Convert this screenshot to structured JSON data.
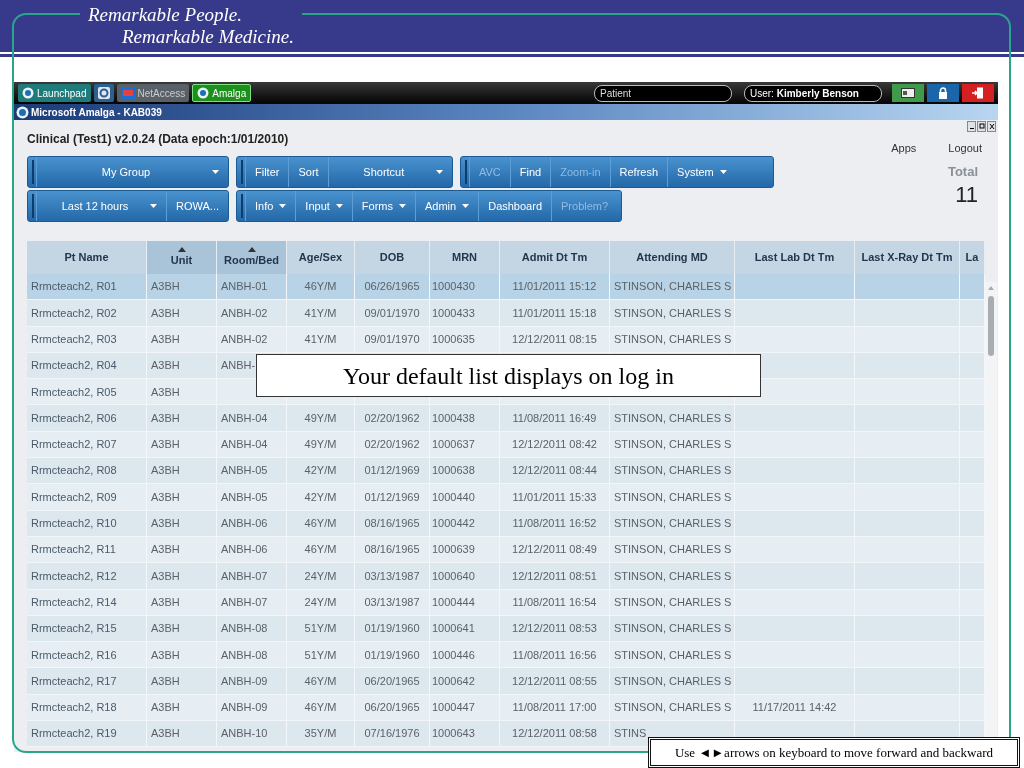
{
  "slide": {
    "tagline": [
      "Remarkable People.",
      "Remarkable Medicine."
    ]
  },
  "taskbar": {
    "tabs": [
      {
        "kind": "launchpad",
        "label": "Launchpad",
        "selected": false
      },
      {
        "kind": "icon",
        "selected": false
      },
      {
        "kind": "netaccess",
        "label": "NetAccess",
        "selected": false
      },
      {
        "kind": "amalga",
        "label": "Amalga",
        "selected": true
      }
    ],
    "patient_field": {
      "placeholder": "Patient"
    },
    "user_field": {
      "value": "User: **Kimberly Benson**"
    }
  },
  "window": {
    "title": "Microsoft Amalga - KAB039"
  },
  "app": {
    "title": "Clinical (Test1) v2.0.24 (Data epoch:1/01/2010)",
    "links": [
      "Apps",
      "Logout"
    ],
    "total": {
      "label": "Total",
      "value": "11"
    },
    "toolbars": [
      [
        {
          "label": "My Group",
          "dropdown": true,
          "disabled": false,
          "grow": true
        }
      ],
      [
        {
          "label": "Filter",
          "dropdown": false,
          "disabled": false
        },
        {
          "label": "Sort",
          "dropdown": false,
          "disabled": false
        },
        {
          "label": "Shortcut",
          "dropdown": true,
          "disabled": false,
          "grow": true
        }
      ],
      [
        {
          "label": "AVC",
          "dropdown": false,
          "disabled": true
        },
        {
          "label": "Find",
          "dropdown": false,
          "disabled": false
        },
        {
          "label": "Zoom-in",
          "dropdown": false,
          "disabled": true
        },
        {
          "label": "Refresh",
          "dropdown": false,
          "disabled": false
        },
        {
          "label": "System",
          "dropdown": true,
          "disabled": false
        }
      ],
      [
        {
          "label": "Last 12 hours",
          "dropdown": true,
          "disabled": false,
          "grow": true
        },
        {
          "label": "ROWA...",
          "dropdown": false,
          "disabled": false
        }
      ],
      [
        {
          "label": "Info",
          "dropdown": true,
          "disabled": false
        },
        {
          "label": "Input",
          "dropdown": true,
          "disabled": false
        },
        {
          "label": "Forms",
          "dropdown": true,
          "disabled": false
        },
        {
          "label": "Admin",
          "dropdown": true,
          "disabled": false
        },
        {
          "label": "Dashboard",
          "dropdown": false,
          "disabled": false
        },
        {
          "label": "Problem?",
          "dropdown": false,
          "disabled": true
        }
      ]
    ]
  },
  "table": {
    "columns": [
      {
        "label": "Pt Name",
        "sorted": false
      },
      {
        "label": "Unit",
        "sorted": true
      },
      {
        "label": "Room/Bed",
        "sorted": true
      },
      {
        "label": "Age/Sex",
        "sorted": false
      },
      {
        "label": "DOB",
        "sorted": false
      },
      {
        "label": "MRN",
        "sorted": false
      },
      {
        "label": "Admit Dt Tm",
        "sorted": false
      },
      {
        "label": "Attending MD",
        "sorted": false
      },
      {
        "label": "Last Lab Dt Tm",
        "sorted": false
      },
      {
        "label": "Last X-Ray Dt Tm",
        "sorted": false
      },
      {
        "label": "La",
        "sorted": false
      }
    ],
    "rows": [
      {
        "selected": true,
        "cells": [
          "Rrmcteach2, R01",
          "A3BH",
          "ANBH-01",
          "46Y/M",
          "06/26/1965",
          "1000430",
          "11/01/2011 15:12",
          "STINSON, CHARLES S"
        ]
      },
      {
        "selected": false,
        "cells": [
          "Rrmcteach2, R02",
          "A3BH",
          "ANBH-02",
          "41Y/M",
          "09/01/1970",
          "1000433",
          "11/01/2011 15:18",
          "STINSON, CHARLES S"
        ]
      },
      {
        "selected": false,
        "cells": [
          "Rrmcteach2, R03",
          "A3BH",
          "ANBH-02",
          "41Y/M",
          "09/01/1970",
          "1000635",
          "12/12/2011 08:15",
          "STINSON, CHARLES S"
        ]
      },
      {
        "selected": false,
        "cells": [
          "Rrmcteach2, R04",
          "A3BH",
          "ANBH-"
        ]
      },
      {
        "selected": false,
        "cells": [
          "Rrmcteach2, R05",
          "A3BH"
        ]
      },
      {
        "selected": false,
        "cells": [
          "Rrmcteach2, R06",
          "A3BH",
          "ANBH-04",
          "49Y/M",
          "02/20/1962",
          "1000438",
          "11/08/2011 16:49",
          "STINSON, CHARLES S"
        ]
      },
      {
        "selected": false,
        "cells": [
          "Rrmcteach2, R07",
          "A3BH",
          "ANBH-04",
          "49Y/M",
          "02/20/1962",
          "1000637",
          "12/12/2011 08:42",
          "STINSON, CHARLES S"
        ]
      },
      {
        "selected": false,
        "cells": [
          "Rrmcteach2, R08",
          "A3BH",
          "ANBH-05",
          "42Y/M",
          "01/12/1969",
          "1000638",
          "12/12/2011 08:44",
          "STINSON, CHARLES S"
        ]
      },
      {
        "selected": false,
        "cells": [
          "Rrmcteach2, R09",
          "A3BH",
          "ANBH-05",
          "42Y/M",
          "01/12/1969",
          "1000440",
          "11/01/2011 15:33",
          "STINSON, CHARLES S"
        ]
      },
      {
        "selected": false,
        "cells": [
          "Rrmcteach2, R10",
          "A3BH",
          "ANBH-06",
          "46Y/M",
          "08/16/1965",
          "1000442",
          "11/08/2011 16:52",
          "STINSON, CHARLES S"
        ]
      },
      {
        "selected": false,
        "cells": [
          "Rrmcteach2, R11",
          "A3BH",
          "ANBH-06",
          "46Y/M",
          "08/16/1965",
          "1000639",
          "12/12/2011 08:49",
          "STINSON, CHARLES S"
        ]
      },
      {
        "selected": false,
        "cells": [
          "Rrmcteach2, R12",
          "A3BH",
          "ANBH-07",
          "24Y/M",
          "03/13/1987",
          "1000640",
          "12/12/2011 08:51",
          "STINSON, CHARLES S"
        ]
      },
      {
        "selected": false,
        "cells": [
          "Rrmcteach2, R14",
          "A3BH",
          "ANBH-07",
          "24Y/M",
          "03/13/1987",
          "1000444",
          "11/08/2011 16:54",
          "STINSON, CHARLES S"
        ]
      },
      {
        "selected": false,
        "cells": [
          "Rrmcteach2, R15",
          "A3BH",
          "ANBH-08",
          "51Y/M",
          "01/19/1960",
          "1000641",
          "12/12/2011 08:53",
          "STINSON, CHARLES S"
        ]
      },
      {
        "selected": false,
        "cells": [
          "Rrmcteach2, R16",
          "A3BH",
          "ANBH-08",
          "51Y/M",
          "01/19/1960",
          "1000446",
          "11/08/2011 16:56",
          "STINSON, CHARLES S"
        ]
      },
      {
        "selected": false,
        "cells": [
          "Rrmcteach2, R17",
          "A3BH",
          "ANBH-09",
          "46Y/M",
          "06/20/1965",
          "1000642",
          "12/12/2011 08:55",
          "STINSON, CHARLES S"
        ]
      },
      {
        "selected": false,
        "cells": [
          "Rrmcteach2, R18",
          "A3BH",
          "ANBH-09",
          "46Y/M",
          "06/20/1965",
          "1000447",
          "11/08/2011 17:00",
          "STINSON, CHARLES S",
          "11/17/2011 14:42"
        ]
      },
      {
        "selected": false,
        "cells": [
          "Rrmcteach2, R19",
          "A3BH",
          "ANBH-10",
          "35Y/M",
          "07/16/1976",
          "1000643",
          "12/12/2011 08:58",
          "STINS"
        ]
      }
    ]
  },
  "callouts": [
    {
      "kind": "main",
      "text": "Your default list displays on log in"
    },
    {
      "kind": "hint",
      "text": "Use ◄►arrows on keyboard to move forward and backward"
    }
  ]
}
